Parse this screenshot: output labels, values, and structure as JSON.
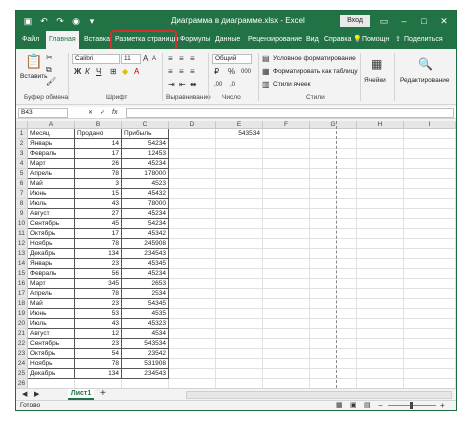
{
  "window": {
    "title": "Диаграмма в диаграмме.xlsx  -  Excel",
    "signin_button": "Вход",
    "title_icons": [
      "save-icon",
      "undo-icon",
      "redo-icon",
      "camera-icon",
      "customize-icon"
    ],
    "window_icons": [
      "ribbon-options-icon",
      "minimize-icon",
      "maximize-icon",
      "close-icon"
    ]
  },
  "menu": {
    "items": [
      "Файл",
      "Главная",
      "Вставка",
      "Разметка страницы",
      "Формулы",
      "Данные",
      "Рецензирование",
      "Вид",
      "Справка",
      "Помощн",
      "Поделиться"
    ],
    "active_index": 1
  },
  "ribbon": {
    "paste_label": "Вставить",
    "font_name": "Calibri",
    "font_size": "11",
    "number_format": "Общий",
    "conditional_formatting": "Условное форматирование",
    "format_as_table": "Форматировать как таблицу",
    "cell_styles": "Стили ячеек",
    "cells_label": "Ячейки",
    "editing_label": "Редактирование",
    "groups": {
      "clipboard": "Буфер обмена",
      "font": "Шрифт",
      "alignment": "Выравнивание",
      "number": "Число",
      "styles": "Стили"
    }
  },
  "formula_bar": {
    "name_box": "B43",
    "fx": "fx",
    "content": ""
  },
  "sheet": {
    "columns": [
      "A",
      "B",
      "C",
      "D",
      "E",
      "F",
      "G",
      "H",
      "I"
    ],
    "row_numbers": [
      "1",
      "2",
      "3",
      "4",
      "5",
      "6",
      "7",
      "8",
      "9",
      "10",
      "11",
      "12",
      "13",
      "14",
      "15",
      "16",
      "17",
      "18",
      "19",
      "20",
      "21",
      "22",
      "23",
      "24",
      "25",
      "26"
    ],
    "header": [
      "Месяц",
      "Продано",
      "Прибыль"
    ],
    "rows": [
      [
        "Январь",
        "14",
        "54234"
      ],
      [
        "Февраль",
        "17",
        "12453"
      ],
      [
        "Март",
        "26",
        "45234"
      ],
      [
        "Апрель",
        "78",
        "178000"
      ],
      [
        "Май",
        "3",
        "4523"
      ],
      [
        "Июнь",
        "15",
        "45432"
      ],
      [
        "Июль",
        "43",
        "78000"
      ],
      [
        "Август",
        "27",
        "45234"
      ],
      [
        "Сентябрь",
        "45",
        "54234"
      ],
      [
        "Октябрь",
        "17",
        "45342"
      ],
      [
        "Ноябрь",
        "78",
        "245908"
      ],
      [
        "Декабрь",
        "134",
        "234543"
      ],
      [
        "Январь",
        "23",
        "45345"
      ],
      [
        "Февраль",
        "56",
        "45234"
      ],
      [
        "Март",
        "345",
        "2653"
      ],
      [
        "Апрель",
        "78",
        "2534"
      ],
      [
        "Май",
        "23",
        "54345"
      ],
      [
        "Июнь",
        "53",
        "4535"
      ],
      [
        "Июль",
        "43",
        "45323"
      ],
      [
        "Август",
        "12",
        "4534"
      ],
      [
        "Сентябрь",
        "23",
        "543534"
      ],
      [
        "Октябрь",
        "54",
        "23542"
      ],
      [
        "Ноябрь",
        "78",
        "531908"
      ],
      [
        "Декабрь",
        "134",
        "234543"
      ]
    ],
    "e1_value": "543534"
  },
  "tabs": {
    "active_sheet": "Лист1",
    "add_sheet": "+"
  },
  "status": {
    "ready": "Готово",
    "zoom_minus": "−",
    "zoom_plus": "+"
  },
  "colors": {
    "brand": "#217346",
    "highlight": "#d62e2e"
  }
}
